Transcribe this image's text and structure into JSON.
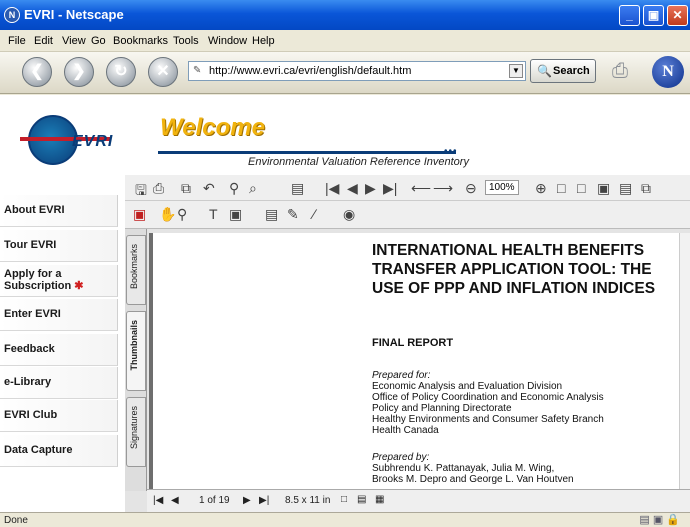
{
  "window": {
    "title": "EVRI - Netscape",
    "icon_text": "N"
  },
  "menu": [
    "File",
    "Edit",
    "View",
    "Go",
    "Bookmarks",
    "Tools",
    "Window",
    "Help"
  ],
  "nav": {
    "url": "http://www.evri.ca/evri/english/default.htm",
    "search_label": "Search"
  },
  "site": {
    "logo_text": "EVRI",
    "welcome": "Welcome",
    "subtitle": "Environmental Valuation Reference Inventory",
    "sidebar": [
      {
        "label": "About EVRI"
      },
      {
        "label": "Tour EVRI"
      },
      {
        "label_line1": "Apply for a",
        "label_line2": "Subscription",
        "marker": "✱"
      },
      {
        "label": "Enter EVRI"
      },
      {
        "label": "Feedback"
      },
      {
        "label": "e-Library"
      },
      {
        "label": "EVRI Club"
      },
      {
        "label": "Data Capture"
      }
    ]
  },
  "pdf": {
    "zoom": "100%",
    "tabs": [
      "Bookmarks",
      "Thumbnails",
      "Signatures"
    ],
    "page_indicator": "1 of 19",
    "page_size": "8.5 x 11 in",
    "doc": {
      "title": "INTERNATIONAL HEALTH BENEFITS TRANSFER APPLICATION TOOL: THE USE OF PPP AND INFLATION INDICES",
      "subtitle": "FINAL REPORT",
      "prepared_for_label": "Prepared for:",
      "prepared_for": [
        "Economic Analysis and Evaluation Division",
        "Office of Policy Coordination and Economic Analysis",
        "Policy and Planning Directorate",
        "Healthy Environments and Consumer Safety Branch",
        "Health Canada"
      ],
      "prepared_by_label": "Prepared by:",
      "prepared_by": [
        "Subhrendu K. Pattanayak, Julia M. Wing,",
        "Brooks M. Depro and George L. Van Houtven"
      ]
    }
  },
  "status": {
    "text": "Done"
  }
}
